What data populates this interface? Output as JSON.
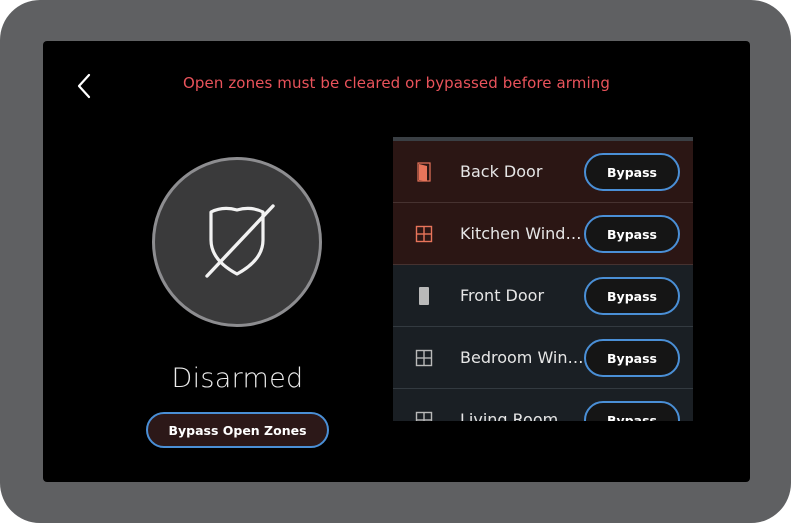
{
  "header": {
    "warning": "Open zones must be cleared or bypassed before arming"
  },
  "status": {
    "label": "Disarmed",
    "icon": "shield-disarmed-icon"
  },
  "actions": {
    "bypass_all_label": "Bypass Open Zones"
  },
  "zones": [
    {
      "name": "Back Door",
      "icon": "door-icon",
      "open": true,
      "button": "Bypass"
    },
    {
      "name": "Kitchen Window",
      "icon": "window-icon",
      "open": true,
      "button": "Bypass"
    },
    {
      "name": "Front Door",
      "icon": "door-icon",
      "open": false,
      "button": "Bypass"
    },
    {
      "name": "Bedroom Window",
      "icon": "window-icon",
      "open": false,
      "button": "Bypass"
    },
    {
      "name": "Living Room",
      "icon": "window-icon",
      "open": false,
      "button": "Bypass"
    }
  ],
  "colors": {
    "warning": "#e9535b",
    "accent_border": "#4a8fd6",
    "open_zone_bg": "#2b1614",
    "closed_zone_bg": "#1a1f24",
    "open_icon": "#e8745a",
    "closed_icon": "#b9b9b9"
  }
}
